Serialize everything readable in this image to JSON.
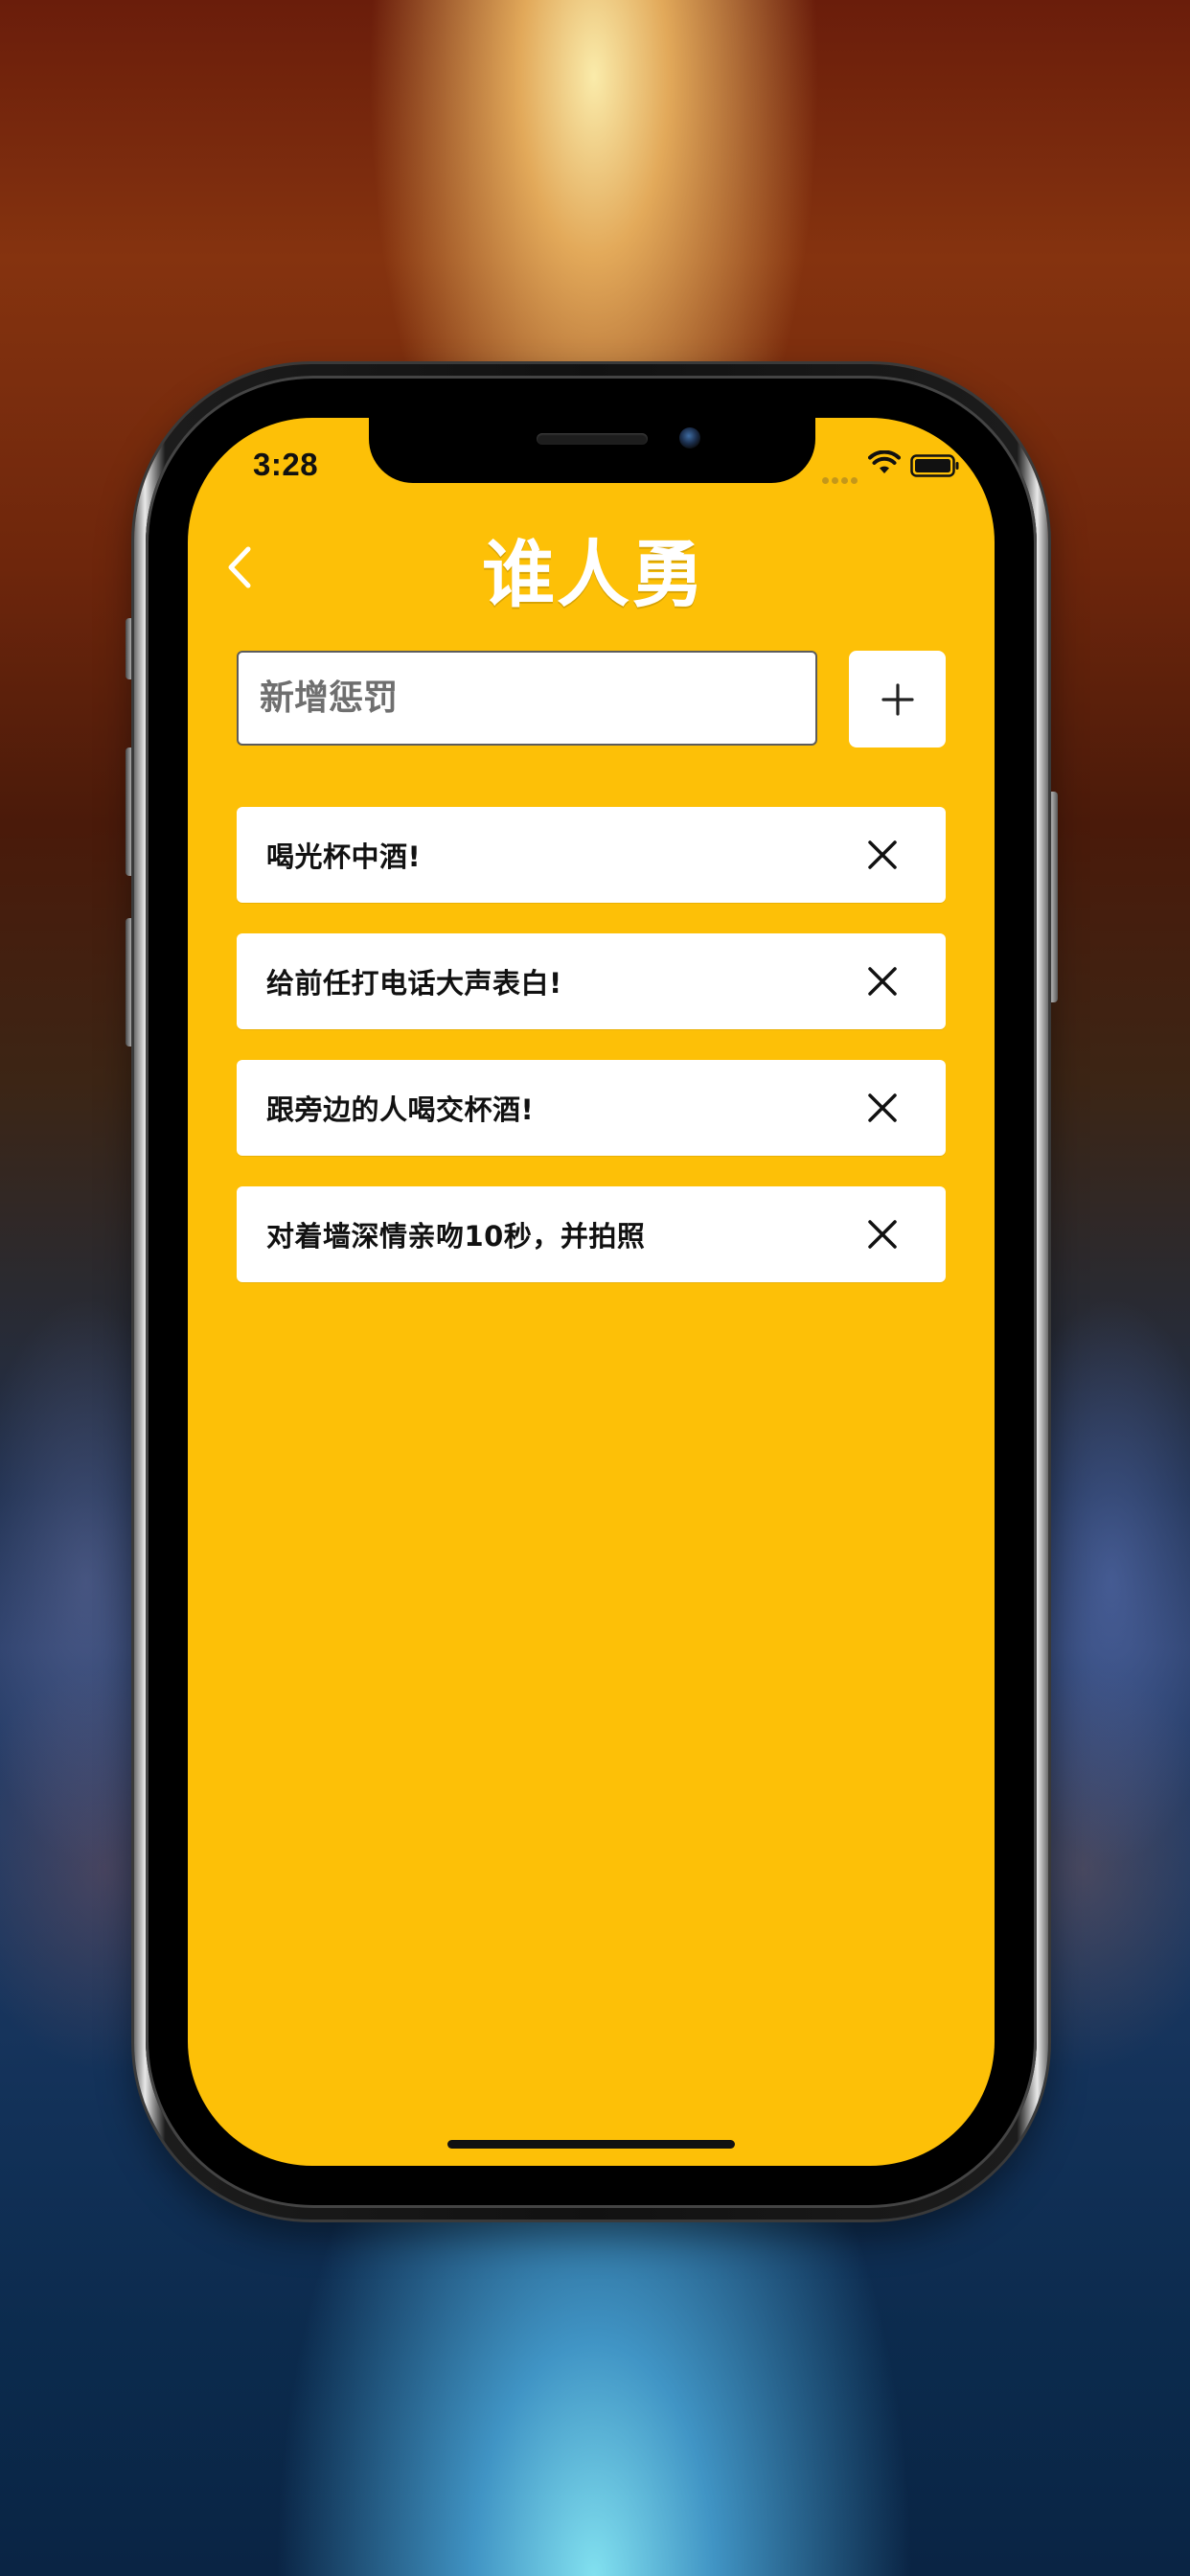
{
  "status_bar": {
    "time": "3:28",
    "wifi_icon": "wifi-icon",
    "battery_icon": "battery-icon"
  },
  "nav": {
    "back_icon": "chevron-left-icon",
    "title": "谁人勇"
  },
  "add_form": {
    "placeholder": "新增惩罚",
    "value": "",
    "add_icon": "plus-icon"
  },
  "penalties": [
    {
      "text": "喝光杯中酒!",
      "delete_icon": "close-icon"
    },
    {
      "text": "给前任打电话大声表白!",
      "delete_icon": "close-icon"
    },
    {
      "text": "跟旁边的人喝交杯酒!",
      "delete_icon": "close-icon"
    },
    {
      "text": "对着墙深情亲吻10秒，并拍照",
      "delete_icon": "close-icon"
    }
  ],
  "colors": {
    "screen_background": "#FDC007",
    "card_background": "#FFFFFF",
    "title_color": "#FFFFFF",
    "text_color": "#111111"
  }
}
